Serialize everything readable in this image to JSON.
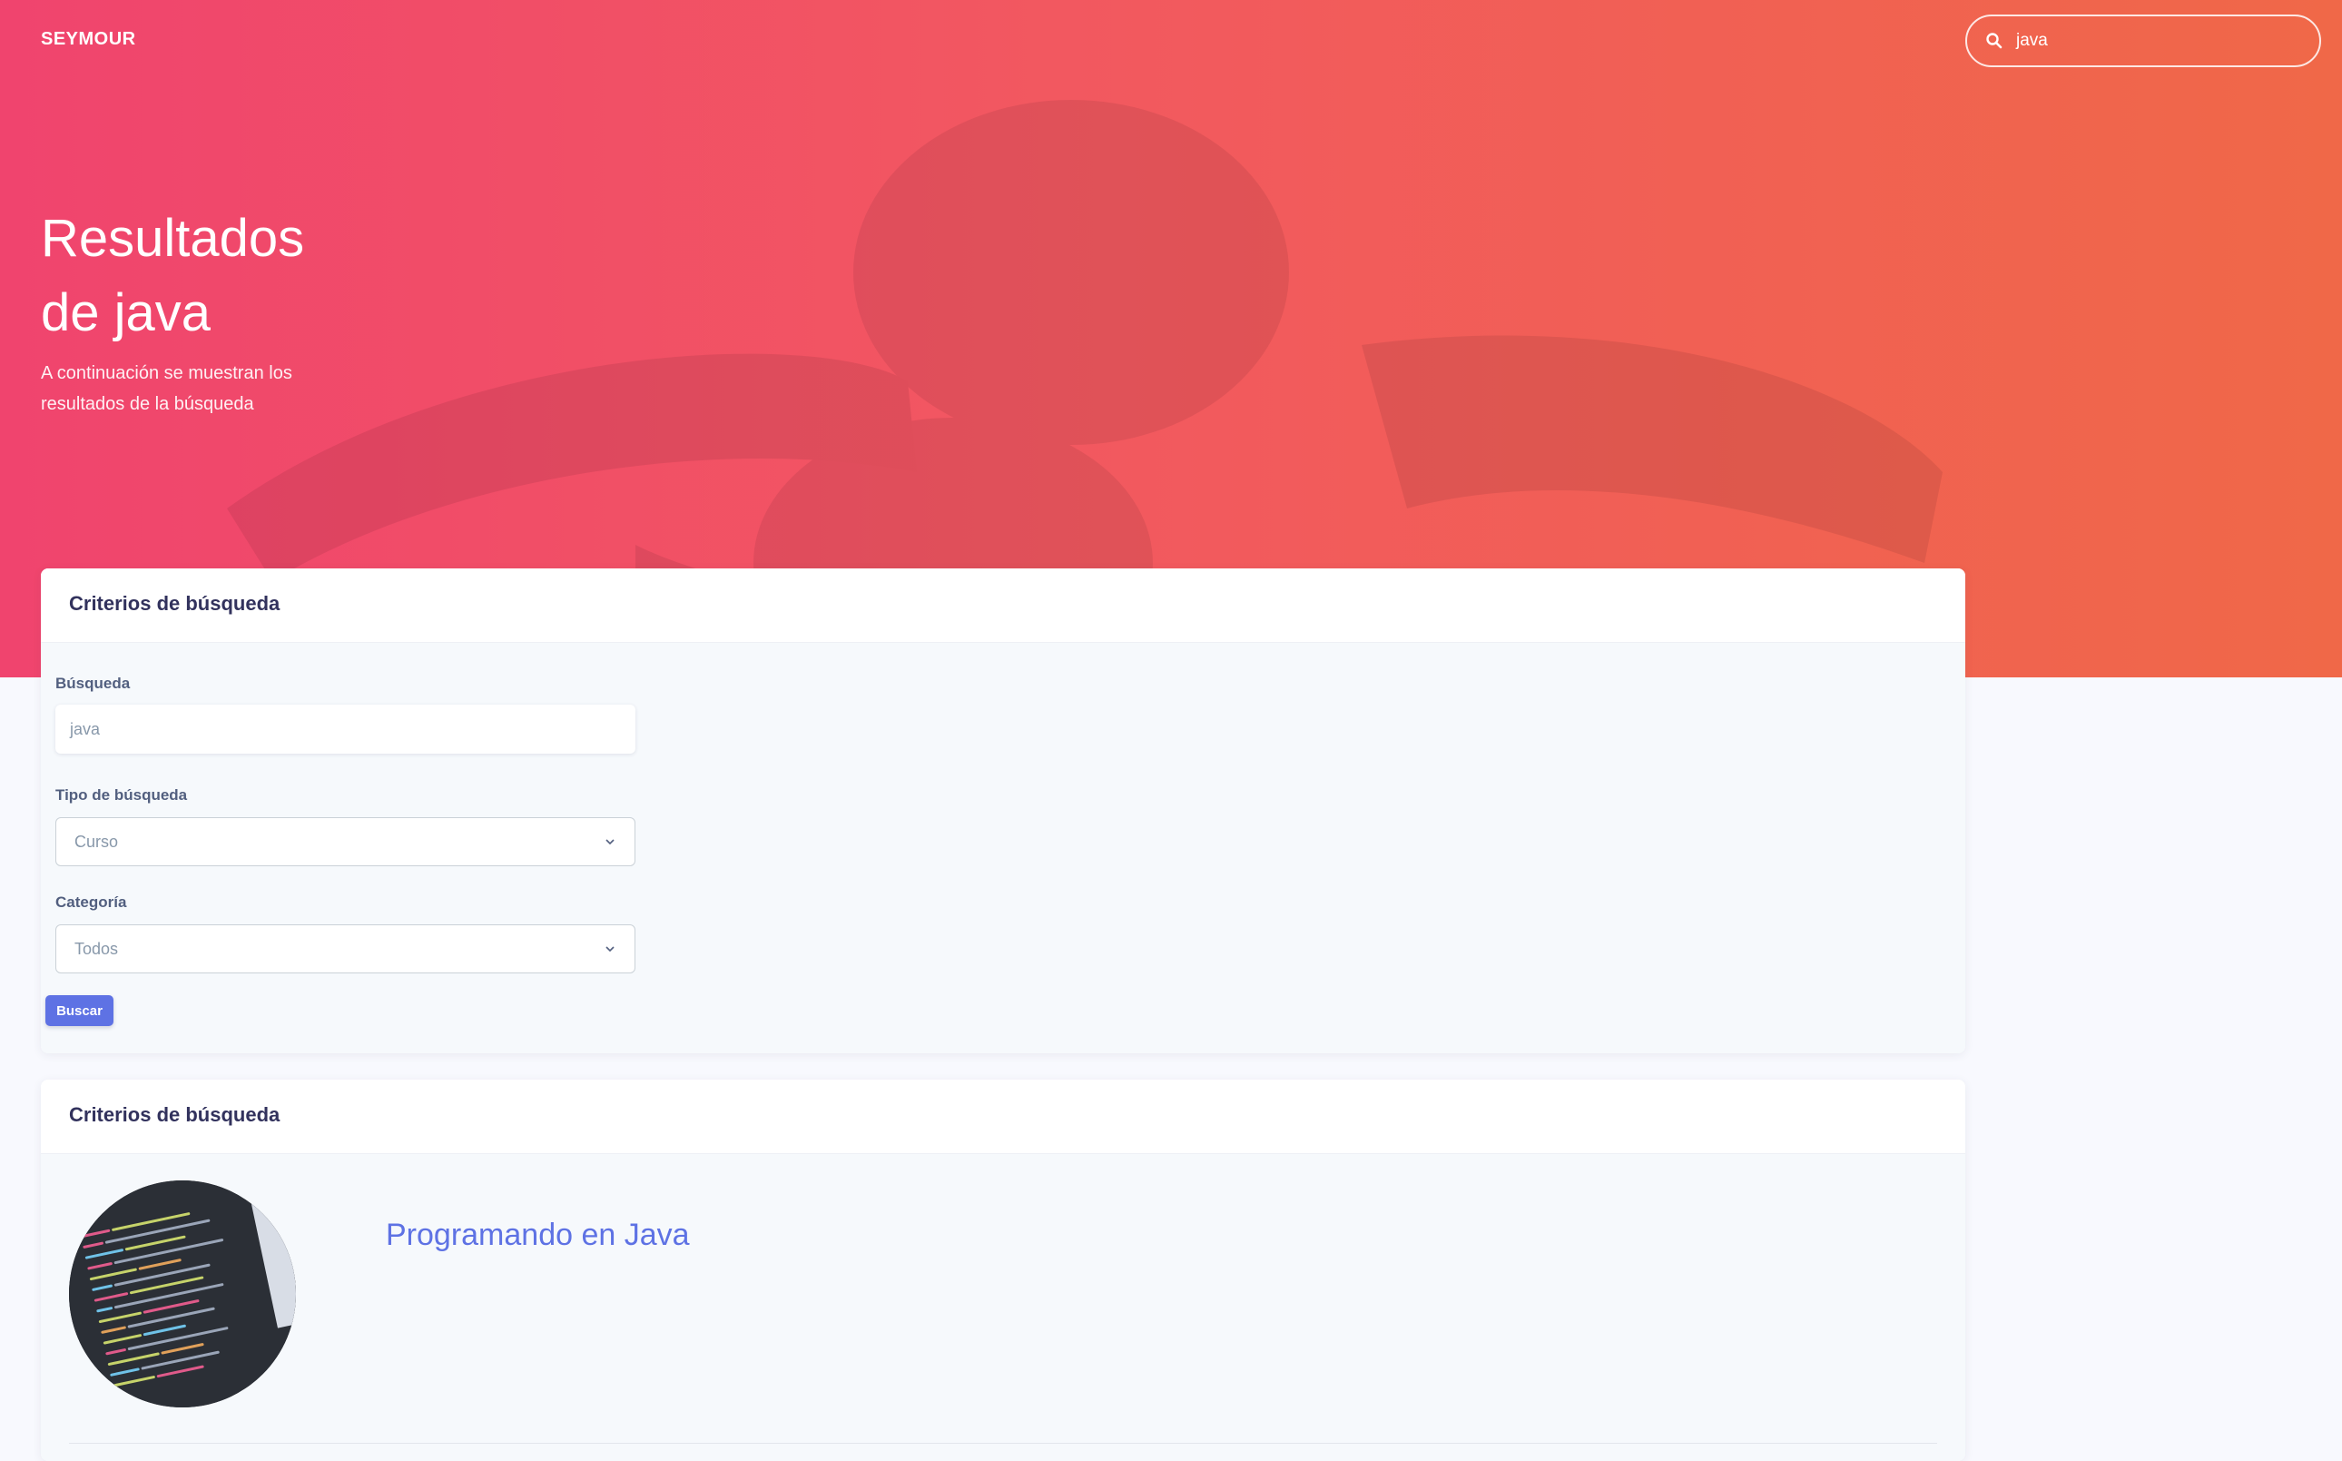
{
  "navbar": {
    "brand": "SEYMOUR",
    "search_value": "java"
  },
  "hero": {
    "title_line1": "Resultados",
    "title_line2": "de java",
    "subtitle": "A continuación se muestran los resultados de la búsqueda"
  },
  "criteria_card": {
    "header": "Criterios de búsqueda",
    "search_label": "Búsqueda",
    "search_value": "java",
    "type_label": "Tipo de búsqueda",
    "type_value": "Curso",
    "category_label": "Categoría",
    "category_value": "Todos",
    "button_label": "Buscar"
  },
  "results_card": {
    "header": "Criterios de búsqueda",
    "results": [
      {
        "title": "Programando en Java",
        "thumbnail": "code-screenshot"
      }
    ]
  },
  "colors": {
    "gradient_start": "#f0446e",
    "gradient_end": "#f06848",
    "accent": "#5e72e4",
    "heading": "#32325d"
  }
}
